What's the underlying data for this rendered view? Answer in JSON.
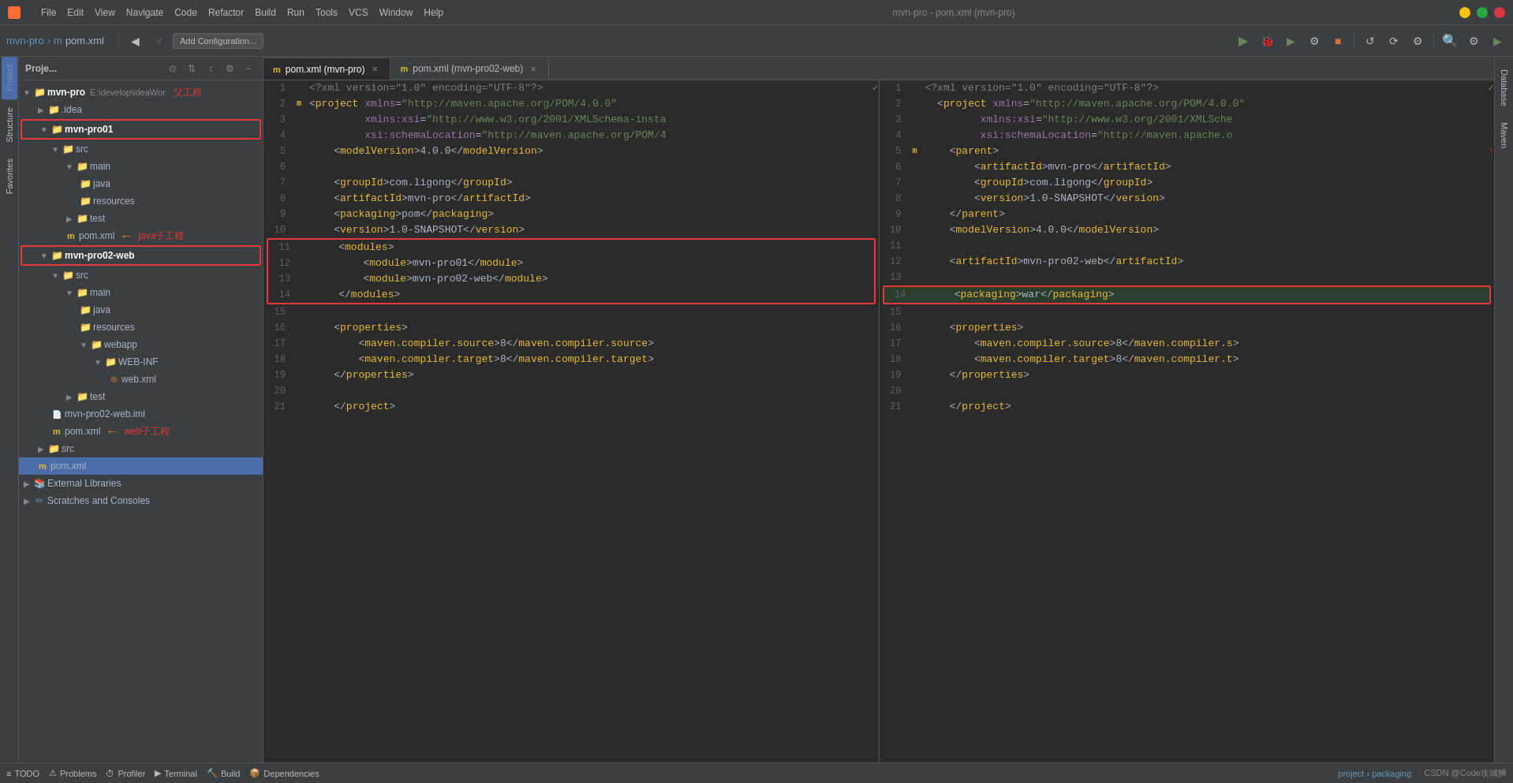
{
  "titleBar": {
    "title": "mvn-pro - pom.xml (mvn-pro)",
    "menus": [
      "File",
      "Edit",
      "View",
      "Navigate",
      "Code",
      "Refactor",
      "Build",
      "Run",
      "Tools",
      "VCS",
      "Window",
      "Help"
    ]
  },
  "toolbar": {
    "breadcrumb": [
      "mvn-pro",
      "pom.xml"
    ],
    "addConfig": "Add Configuration...",
    "runBtnLabel": "▶",
    "debugBtnLabel": "🐞"
  },
  "projectPanel": {
    "title": "Proje...",
    "items": [
      {
        "id": "mvn-pro",
        "label": "mvn-pro",
        "sublabel": "E:\\develop\\ideaWor",
        "indent": 0,
        "type": "folder",
        "open": true
      },
      {
        "id": "idea",
        "label": ".idea",
        "indent": 1,
        "type": "folder",
        "open": false
      },
      {
        "id": "mvn-pro01",
        "label": "mvn-pro01",
        "indent": 1,
        "type": "folder",
        "open": true,
        "redBorder": true
      },
      {
        "id": "src1",
        "label": "src",
        "indent": 2,
        "type": "folder",
        "open": true
      },
      {
        "id": "main1",
        "label": "main",
        "indent": 3,
        "type": "folder",
        "open": true
      },
      {
        "id": "java1",
        "label": "java",
        "indent": 4,
        "type": "folder"
      },
      {
        "id": "resources1",
        "label": "resources",
        "indent": 4,
        "type": "folder"
      },
      {
        "id": "test1",
        "label": "test",
        "indent": 3,
        "type": "folder",
        "open": false
      },
      {
        "id": "pom1",
        "label": "pom.xml",
        "indent": 3,
        "type": "xml"
      },
      {
        "id": "mvn-pro02-web",
        "label": "mvn-pro02-web",
        "indent": 1,
        "type": "folder",
        "open": true,
        "redBorder": true
      },
      {
        "id": "src2",
        "label": "src",
        "indent": 2,
        "type": "folder",
        "open": true
      },
      {
        "id": "main2",
        "label": "main",
        "indent": 3,
        "type": "folder",
        "open": true
      },
      {
        "id": "java2",
        "label": "java",
        "indent": 4,
        "type": "folder"
      },
      {
        "id": "resources2",
        "label": "resources",
        "indent": 4,
        "type": "folder"
      },
      {
        "id": "webapp",
        "label": "webapp",
        "indent": 4,
        "type": "folder",
        "open": true
      },
      {
        "id": "webinf",
        "label": "WEB-INF",
        "indent": 5,
        "type": "folder",
        "open": true
      },
      {
        "id": "webxml",
        "label": "web.xml",
        "indent": 6,
        "type": "xml"
      },
      {
        "id": "test2",
        "label": "test",
        "indent": 3,
        "type": "folder",
        "open": false
      },
      {
        "id": "iml",
        "label": "mvn-pro02-web.iml",
        "indent": 2,
        "type": "iml"
      },
      {
        "id": "pom2",
        "label": "pom.xml",
        "indent": 2,
        "type": "xml"
      },
      {
        "id": "src3",
        "label": "src",
        "indent": 1,
        "type": "folder",
        "open": false
      },
      {
        "id": "pom3",
        "label": "pom.xml",
        "indent": 1,
        "type": "xml",
        "selected": true
      },
      {
        "id": "extlib",
        "label": "External Libraries",
        "indent": 0,
        "type": "folder",
        "open": false
      },
      {
        "id": "scratches",
        "label": "Scratches and Consoles",
        "indent": 0,
        "type": "folder",
        "open": false
      }
    ]
  },
  "tabs": {
    "left": {
      "name": "pom.xml (mvn-pro)",
      "icon": "m"
    },
    "right": {
      "name": "pom.xml (mvn-pro02-web)",
      "icon": "m"
    }
  },
  "leftEditor": {
    "annotation1": "父工程",
    "annotation2": "java子工程",
    "annotation3": "web子工程",
    "lines": [
      {
        "num": 1,
        "content": "<?xml version=\"1.0\" encoding=\"UTF-8\"?>",
        "type": "prolog"
      },
      {
        "num": 2,
        "content": "  <project xmlns=\"http://maven.apache.org/POM/4.0.0\"",
        "type": "tag"
      },
      {
        "num": 3,
        "content": "           xmlns:xsi=\"http://www.w3.org/2001/XMLSchema-insta",
        "type": "attr"
      },
      {
        "num": 4,
        "content": "           xsi:schemaLocation=\"http://maven.apache.org/POM/4",
        "type": "attr"
      },
      {
        "num": 5,
        "content": "    <modelVersion>4.0.0</modelVersion>",
        "type": "tag"
      },
      {
        "num": 6,
        "content": "",
        "type": "empty"
      },
      {
        "num": 7,
        "content": "    <groupId>com.ligong</groupId>",
        "type": "tag"
      },
      {
        "num": 8,
        "content": "    <artifactId>mvn-pro</artifactId>",
        "type": "tag"
      },
      {
        "num": 9,
        "content": "    <packaging>pom</packaging>",
        "type": "tag"
      },
      {
        "num": 10,
        "content": "    <version>1.0-SNAPSHOT</version>",
        "type": "tag"
      },
      {
        "num": 11,
        "content": "    <modules>",
        "type": "tag",
        "boxStart": true
      },
      {
        "num": 12,
        "content": "        <module>mvn-pro01</module>",
        "type": "tag"
      },
      {
        "num": 13,
        "content": "        <module>mvn-pro02-web</module>",
        "type": "tag"
      },
      {
        "num": 14,
        "content": "    </modules>",
        "type": "tag",
        "boxEnd": true
      },
      {
        "num": 15,
        "content": "",
        "type": "empty"
      },
      {
        "num": 16,
        "content": "    <properties>",
        "type": "tag"
      },
      {
        "num": 17,
        "content": "        <maven.compiler.source>8</maven.compiler.source>",
        "type": "tag"
      },
      {
        "num": 18,
        "content": "        <maven.compiler.target>8</maven.compiler.target>",
        "type": "tag"
      },
      {
        "num": 19,
        "content": "    </properties>",
        "type": "tag"
      },
      {
        "num": 20,
        "content": "",
        "type": "empty"
      },
      {
        "num": 21,
        "content": "    </project>",
        "type": "tag"
      }
    ]
  },
  "rightEditor": {
    "lines": [
      {
        "num": 1,
        "content": "<?xml version=\"1.0\" encoding=\"UTF-8\"?>",
        "type": "prolog"
      },
      {
        "num": 2,
        "content": "  <project xmlns=\"http://maven.apache.org/POM/4.0.0\"",
        "type": "tag"
      },
      {
        "num": 3,
        "content": "           xmlns:xsi=\"http://www.w3.org/2001/XMLSche",
        "type": "attr"
      },
      {
        "num": 4,
        "content": "           xsi:schemaLocation=\"http://maven.apache.o",
        "type": "attr"
      },
      {
        "num": 5,
        "content": "    <parent>",
        "type": "tag"
      },
      {
        "num": 6,
        "content": "        <artifactId>mvn-pro</artifactId>",
        "type": "tag"
      },
      {
        "num": 7,
        "content": "        <groupId>com.ligong</groupId>",
        "type": "tag"
      },
      {
        "num": 8,
        "content": "        <version>1.0-SNAPSHOT</version>",
        "type": "tag"
      },
      {
        "num": 9,
        "content": "    </parent>",
        "type": "tag"
      },
      {
        "num": 10,
        "content": "    <modelVersion>4.0.0</modelVersion>",
        "type": "tag"
      },
      {
        "num": 11,
        "content": "",
        "type": "empty"
      },
      {
        "num": 12,
        "content": "    <artifactId>mvn-pro02-web</artifactId>",
        "type": "tag"
      },
      {
        "num": 13,
        "content": "",
        "type": "empty"
      },
      {
        "num": 14,
        "content": "    <packaging>war</packaging>",
        "type": "tag",
        "boxed": true
      },
      {
        "num": 15,
        "content": "",
        "type": "empty"
      },
      {
        "num": 16,
        "content": "    <properties>",
        "type": "tag"
      },
      {
        "num": 17,
        "content": "        <maven.compiler.source>8</maven.compiler.s",
        "type": "tag"
      },
      {
        "num": 18,
        "content": "        <maven.compiler.target>8</maven.compiler.t",
        "type": "tag"
      },
      {
        "num": 19,
        "content": "    </properties>",
        "type": "tag"
      },
      {
        "num": 20,
        "content": "",
        "type": "empty"
      },
      {
        "num": 21,
        "content": "    </project>",
        "type": "tag"
      }
    ]
  },
  "statusBar": {
    "todo": "TODO",
    "problems": "Problems",
    "profiler": "Profiler",
    "terminal": "Terminal",
    "build": "Build",
    "dependencies": "Dependencies",
    "breadcrumb": "project › packaging",
    "watermark": "CSDN @Code攻城狮"
  },
  "rightSidebar": {
    "database": "Database",
    "maven": "Maven"
  }
}
